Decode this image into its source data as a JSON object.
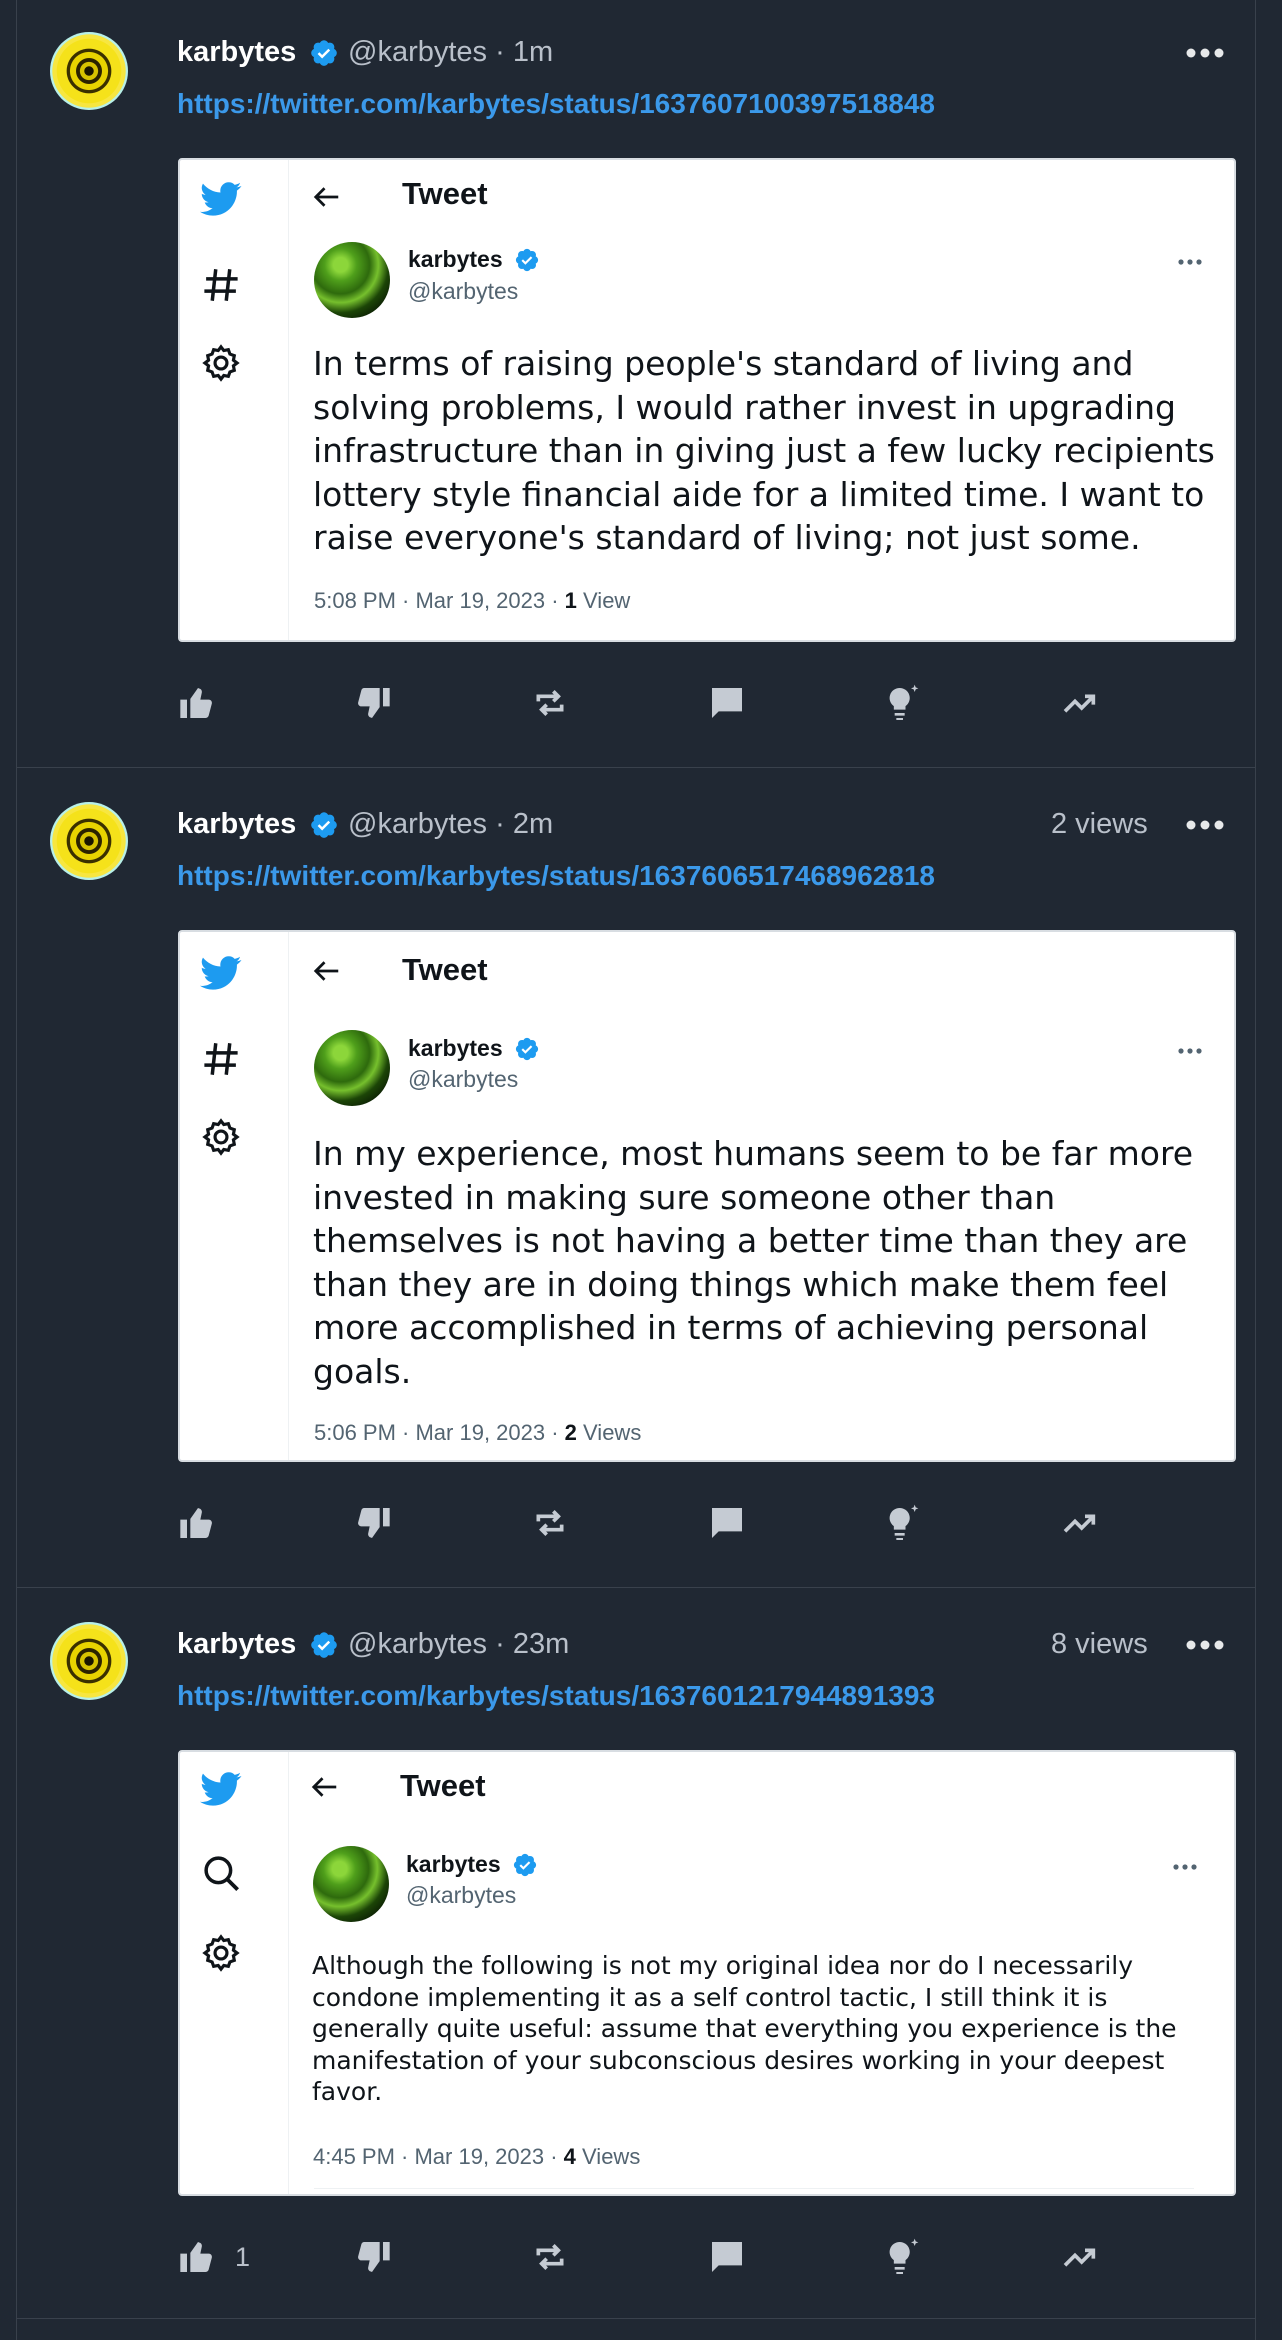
{
  "posts": [
    {
      "author": "karbytes",
      "handle": "@karbytes",
      "time_ago": "· 1m",
      "views": "",
      "link": "https://twitter.com/karbytes/status/1637607100397518848",
      "embed": {
        "title": "Tweet",
        "sidebar_icons": [
          "twitter-bird-icon",
          "hashtag-icon",
          "gear-icon"
        ],
        "author": "karbytes",
        "handle": "@karbytes",
        "text": "In terms of raising people's standard of living and solving problems, I would rather invest in upgrading infrastructure than in giving just a few lucky recipients lottery style financial aide for a limited time. I want to raise everyone's standard of living; not just some.",
        "timestamp": "5:08 PM · Mar 19, 2023 · ",
        "view_count": "1",
        "view_label": " View"
      },
      "likes": ""
    },
    {
      "author": "karbytes",
      "handle": "@karbytes",
      "time_ago": "· 2m",
      "views": "2 views",
      "link": "https://twitter.com/karbytes/status/1637606517468962818",
      "embed": {
        "title": "Tweet",
        "sidebar_icons": [
          "twitter-bird-icon",
          "hashtag-icon",
          "gear-icon"
        ],
        "author": "karbytes",
        "handle": "@karbytes",
        "text": "In my experience, most humans seem to be far more invested in making sure someone other than themselves is not having a better time than they are than they are in doing things which make them feel more accomplished in terms of achieving personal goals.",
        "timestamp": "5:06 PM · Mar 19, 2023 · ",
        "view_count": "2",
        "view_label": " Views"
      },
      "likes": ""
    },
    {
      "author": "karbytes",
      "handle": "@karbytes",
      "time_ago": "· 23m",
      "views": "8 views",
      "link": "https://twitter.com/karbytes/status/1637601217944891393",
      "embed": {
        "title": "Tweet",
        "sidebar_icons": [
          "twitter-bird-icon",
          "search-icon",
          "gear-icon"
        ],
        "author": "karbytes",
        "handle": "@karbytes",
        "text": "Although the following is not my original idea nor do I necessarily condone implementing it as a self control tactic, I still think it is generally quite useful: assume that everything you experience is the manifestation of your subconscious desires working in your deepest favor.",
        "timestamp": "4:45 PM · Mar 19, 2023 · ",
        "view_count": "4",
        "view_label": " Views"
      },
      "likes": "1"
    }
  ],
  "colors": {
    "background": "#202833",
    "link": "#3b99ea",
    "verified": "#1d9bf0",
    "muted": "#b9c0ca"
  }
}
